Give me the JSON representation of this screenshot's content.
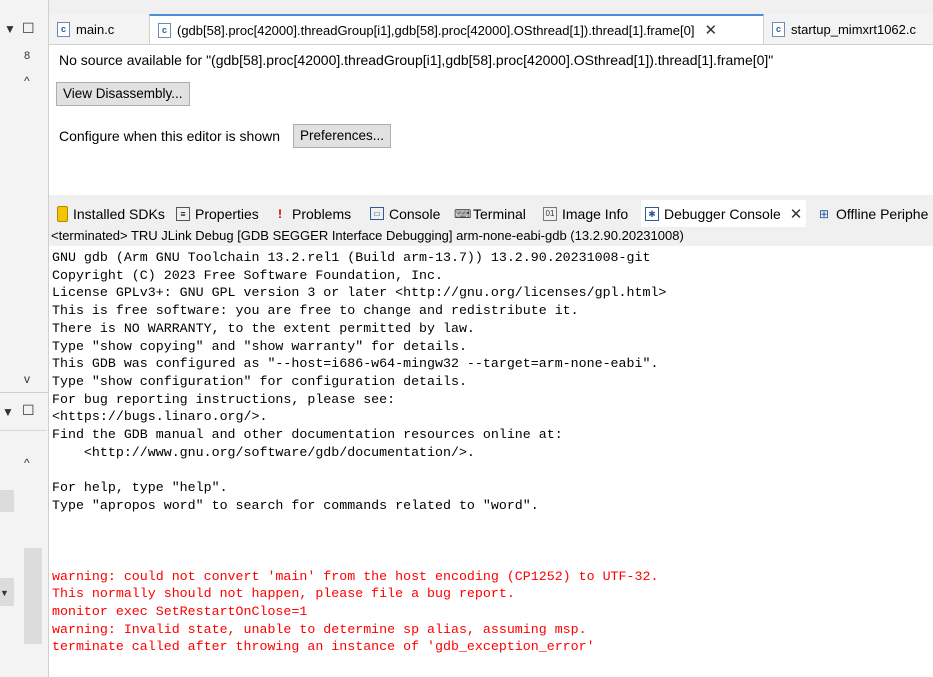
{
  "editor_tabs": [
    {
      "label": "main.c",
      "active": false
    },
    {
      "label": "(gdb[58].proc[42000].threadGroup[i1],gdb[58].proc[42000].OSthread[1]).thread[1].frame[0]",
      "active": true
    },
    {
      "label": "startup_mimxrt1062.c",
      "active": false
    }
  ],
  "editor": {
    "no_source_message": "No source available for \"(gdb[58].proc[42000].threadGroup[i1],gdb[58].proc[42000].OSthread[1]).thread[1].frame[0]\"",
    "view_disassembly_label": "View Disassembly...",
    "configure_label": "Configure when this editor is shown",
    "preferences_label": "Preferences..."
  },
  "view_tabs": [
    {
      "label": "Installed SDKs",
      "icon": "sdk-icon"
    },
    {
      "label": "Properties",
      "icon": "properties-icon"
    },
    {
      "label": "Problems",
      "icon": "problems-icon"
    },
    {
      "label": "Console",
      "icon": "console-icon"
    },
    {
      "label": "Terminal",
      "icon": "terminal-icon"
    },
    {
      "label": "Image Info",
      "icon": "image-info-icon"
    },
    {
      "label": "Debugger Console",
      "icon": "debugger-console-icon",
      "active": true
    },
    {
      "label": "Offline Periphe",
      "icon": "offline-peripherals-icon"
    }
  ],
  "console": {
    "header": "<terminated> TRU JLink Debug [GDB SEGGER Interface Debugging] arm-none-eabi-gdb (13.2.90.20231008)",
    "lines": [
      {
        "text": "GNU gdb (Arm GNU Toolchain 13.2.rel1 (Build arm-13.7)) 13.2.90.20231008-git",
        "error": false
      },
      {
        "text": "Copyright (C) 2023 Free Software Foundation, Inc.",
        "error": false
      },
      {
        "text": "License GPLv3+: GNU GPL version 3 or later <http://gnu.org/licenses/gpl.html>",
        "error": false
      },
      {
        "text": "This is free software: you are free to change and redistribute it.",
        "error": false
      },
      {
        "text": "There is NO WARRANTY, to the extent permitted by law.",
        "error": false
      },
      {
        "text": "Type \"show copying\" and \"show warranty\" for details.",
        "error": false
      },
      {
        "text": "This GDB was configured as \"--host=i686-w64-mingw32 --target=arm-none-eabi\".",
        "error": false
      },
      {
        "text": "Type \"show configuration\" for configuration details.",
        "error": false
      },
      {
        "text": "For bug reporting instructions, please see:",
        "error": false
      },
      {
        "text": "<https://bugs.linaro.org/>.",
        "error": false
      },
      {
        "text": "Find the GDB manual and other documentation resources online at:",
        "error": false
      },
      {
        "text": "    <http://www.gnu.org/software/gdb/documentation/>.",
        "error": false
      },
      {
        "text": "",
        "error": false
      },
      {
        "text": "For help, type \"help\".",
        "error": false
      },
      {
        "text": "Type \"apropos word\" to search for commands related to \"word\".",
        "error": false
      },
      {
        "text": "",
        "error": false
      },
      {
        "text": "",
        "error": false
      },
      {
        "text": "",
        "error": false
      },
      {
        "text": "warning: could not convert 'main' from the host encoding (CP1252) to UTF-32.",
        "error": true
      },
      {
        "text": "This normally should not happen, please file a bug report.",
        "error": true
      },
      {
        "text": "monitor exec SetRestartOnClose=1",
        "error": true
      },
      {
        "text": "warning: Invalid state, unable to determine sp alias, assuming msp.",
        "error": true
      },
      {
        "text": "terminate called after throwing an instance of 'gdb_exception_error'",
        "error": true
      }
    ]
  },
  "colors": {
    "error_text": "#ff0000",
    "active_tab_accent": "#4a90d9"
  }
}
